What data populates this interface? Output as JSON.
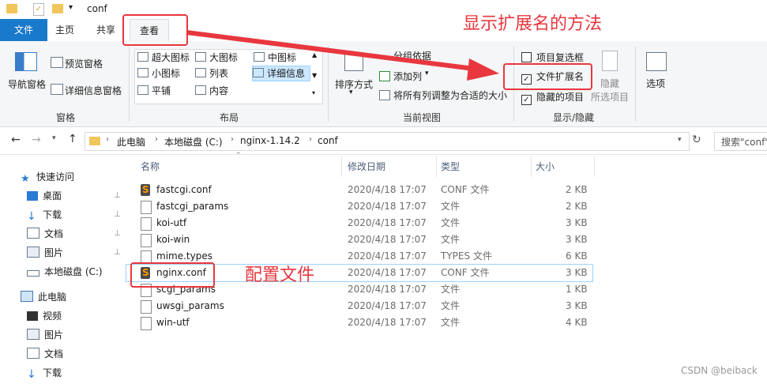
{
  "window": {
    "path_title": "conf"
  },
  "tabs": [
    "文件",
    "主页",
    "共享",
    "查看"
  ],
  "ribbon": {
    "pane": {
      "nav_pane": "导航窗格",
      "preview_pane": "预览窗格",
      "details_pane": "详细信息窗格",
      "group": "窗格"
    },
    "layout": {
      "items": [
        "超大图标",
        "大图标",
        "中图标",
        "小图标",
        "列表",
        "详细信息",
        "平铺",
        "内容"
      ],
      "group": "布局"
    },
    "current_view": {
      "sort_by": "排序方式",
      "group_by": "分组依据",
      "add_columns": "添加列",
      "size_all_columns": "将所有列调整为合适的大小",
      "group": "当前视图"
    },
    "show_hide": {
      "item_checkboxes": "项目复选框",
      "file_name_extensions": "文件扩展名",
      "hidden_items": "隐藏的项目",
      "hide_selected": "隐藏",
      "hide_selected_sub": "所选项目",
      "group": "显示/隐藏",
      "checks": {
        "item_checkboxes": false,
        "file_name_extensions": true,
        "hidden_items": true
      }
    },
    "options": "选项"
  },
  "annotation": {
    "title": "显示扩展名的方法",
    "config_label": "配置文件"
  },
  "address": {
    "crumbs": [
      "此电脑",
      "本地磁盘 (C:)",
      "nginx-1.14.2",
      "conf"
    ],
    "search_placeholder": "搜索\"conf\""
  },
  "nav": {
    "quick_access": "快速访问",
    "quick_items": [
      "桌面",
      "下载",
      "文档",
      "图片",
      "本地磁盘 (C:)"
    ],
    "this_pc": "此电脑",
    "pc_items": [
      "视频",
      "图片",
      "文档",
      "下载"
    ]
  },
  "columns": [
    "名称",
    "修改日期",
    "类型",
    "大小"
  ],
  "files": [
    {
      "name": "fastcgi.conf",
      "date": "2020/4/18 17:07",
      "type": "CONF 文件",
      "size": "2 KB",
      "icon": "sublime-icon"
    },
    {
      "name": "fastcgi_params",
      "date": "2020/4/18 17:07",
      "type": "文件",
      "size": "2 KB",
      "icon": "file-icon"
    },
    {
      "name": "koi-utf",
      "date": "2020/4/18 17:07",
      "type": "文件",
      "size": "3 KB",
      "icon": "file-icon"
    },
    {
      "name": "koi-win",
      "date": "2020/4/18 17:07",
      "type": "文件",
      "size": "3 KB",
      "icon": "file-icon"
    },
    {
      "name": "mime.types",
      "date": "2020/4/18 17:07",
      "type": "TYPES 文件",
      "size": "6 KB",
      "icon": "file-icon"
    },
    {
      "name": "nginx.conf",
      "date": "2020/4/18 17:07",
      "type": "CONF 文件",
      "size": "3 KB",
      "icon": "sublime-icon"
    },
    {
      "name": "scgi_params",
      "date": "2020/4/18 17:07",
      "type": "文件",
      "size": "1 KB",
      "icon": "file-icon"
    },
    {
      "name": "uwsgi_params",
      "date": "2020/4/18 17:07",
      "type": "文件",
      "size": "3 KB",
      "icon": "file-icon"
    },
    {
      "name": "win-utf",
      "date": "2020/4/18 17:07",
      "type": "文件",
      "size": "4 KB",
      "icon": "file-icon"
    }
  ],
  "watermark": "CSDN @beiback",
  "colors": {
    "accent": "#1979ca",
    "highlight": "#e8373e",
    "selection": "#cce8ff"
  }
}
